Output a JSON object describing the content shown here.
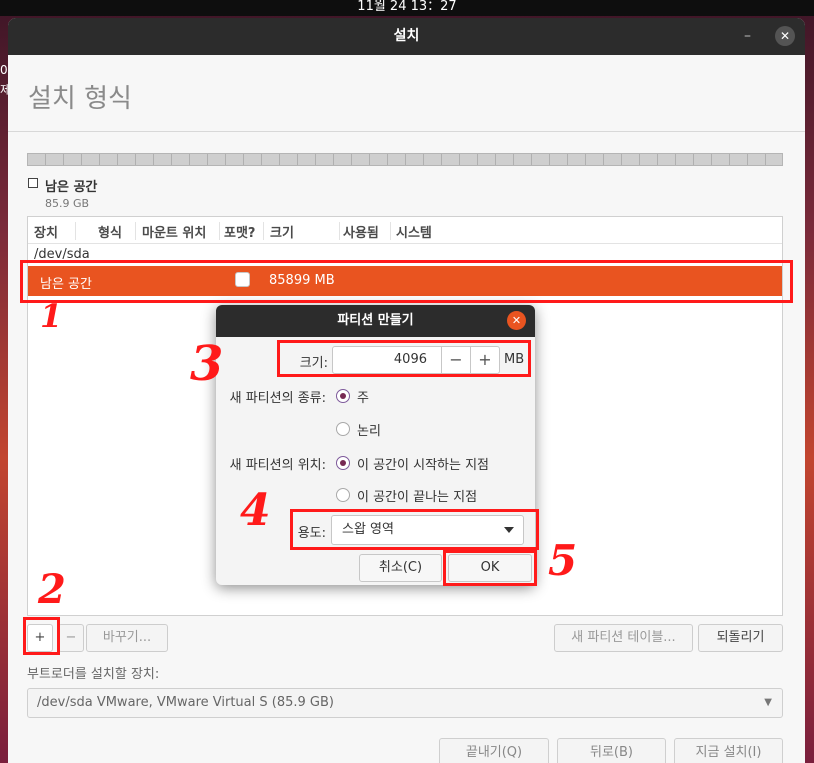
{
  "system": {
    "clock": "11월 24  13：27",
    "left_fragment": "0\n제"
  },
  "window": {
    "title": "설치",
    "minimize_glyph": "–",
    "close_glyph": "✕"
  },
  "page": {
    "title": "설치 형식"
  },
  "legend": {
    "label": "남은 공간",
    "size": "85.9 GB"
  },
  "table": {
    "headers": [
      "장치",
      "형식",
      "마운트 위치",
      "포맷?",
      "크기",
      "사용됨",
      "시스템"
    ],
    "device": "/dev/sda",
    "selected_row": {
      "name": "남은 공간",
      "format_checked": false,
      "size": "85899 MB"
    }
  },
  "toolbar": {
    "add_label": "+",
    "remove_label": "−",
    "change_label": "바꾸기...",
    "new_table_label": "새 파티션 테이블...",
    "revert_label": "되돌리기"
  },
  "bootloader": {
    "label": "부트로더를 설치할 장치:",
    "value": "/dev/sda VMware, VMware Virtual S (85.9 GB)"
  },
  "footer": {
    "quit_label": "끝내기(Q)",
    "back_label": "뒤로(B)",
    "install_label": "지금 설치(I)"
  },
  "dialog": {
    "title": "파티션 만들기",
    "close_glyph": "✕",
    "size_label": "크기:",
    "size_value": "4096",
    "minus": "−",
    "plus": "+",
    "unit": "MB",
    "type_label": "새 파티션의 종류:",
    "type_primary": "주",
    "type_logical": "논리",
    "location_label": "새 파티션의 위치:",
    "location_begin": "이 공간이 시작하는 지점",
    "location_end": "이 공간이 끝나는 지점",
    "usage_label": "용도:",
    "usage_value": "스왑 영역",
    "cancel_label": "취소(C)",
    "ok_label": "OK"
  },
  "annotations": {
    "marks": [
      "1",
      "2",
      "3",
      "4",
      "5"
    ],
    "color": "#ff1a1a"
  }
}
